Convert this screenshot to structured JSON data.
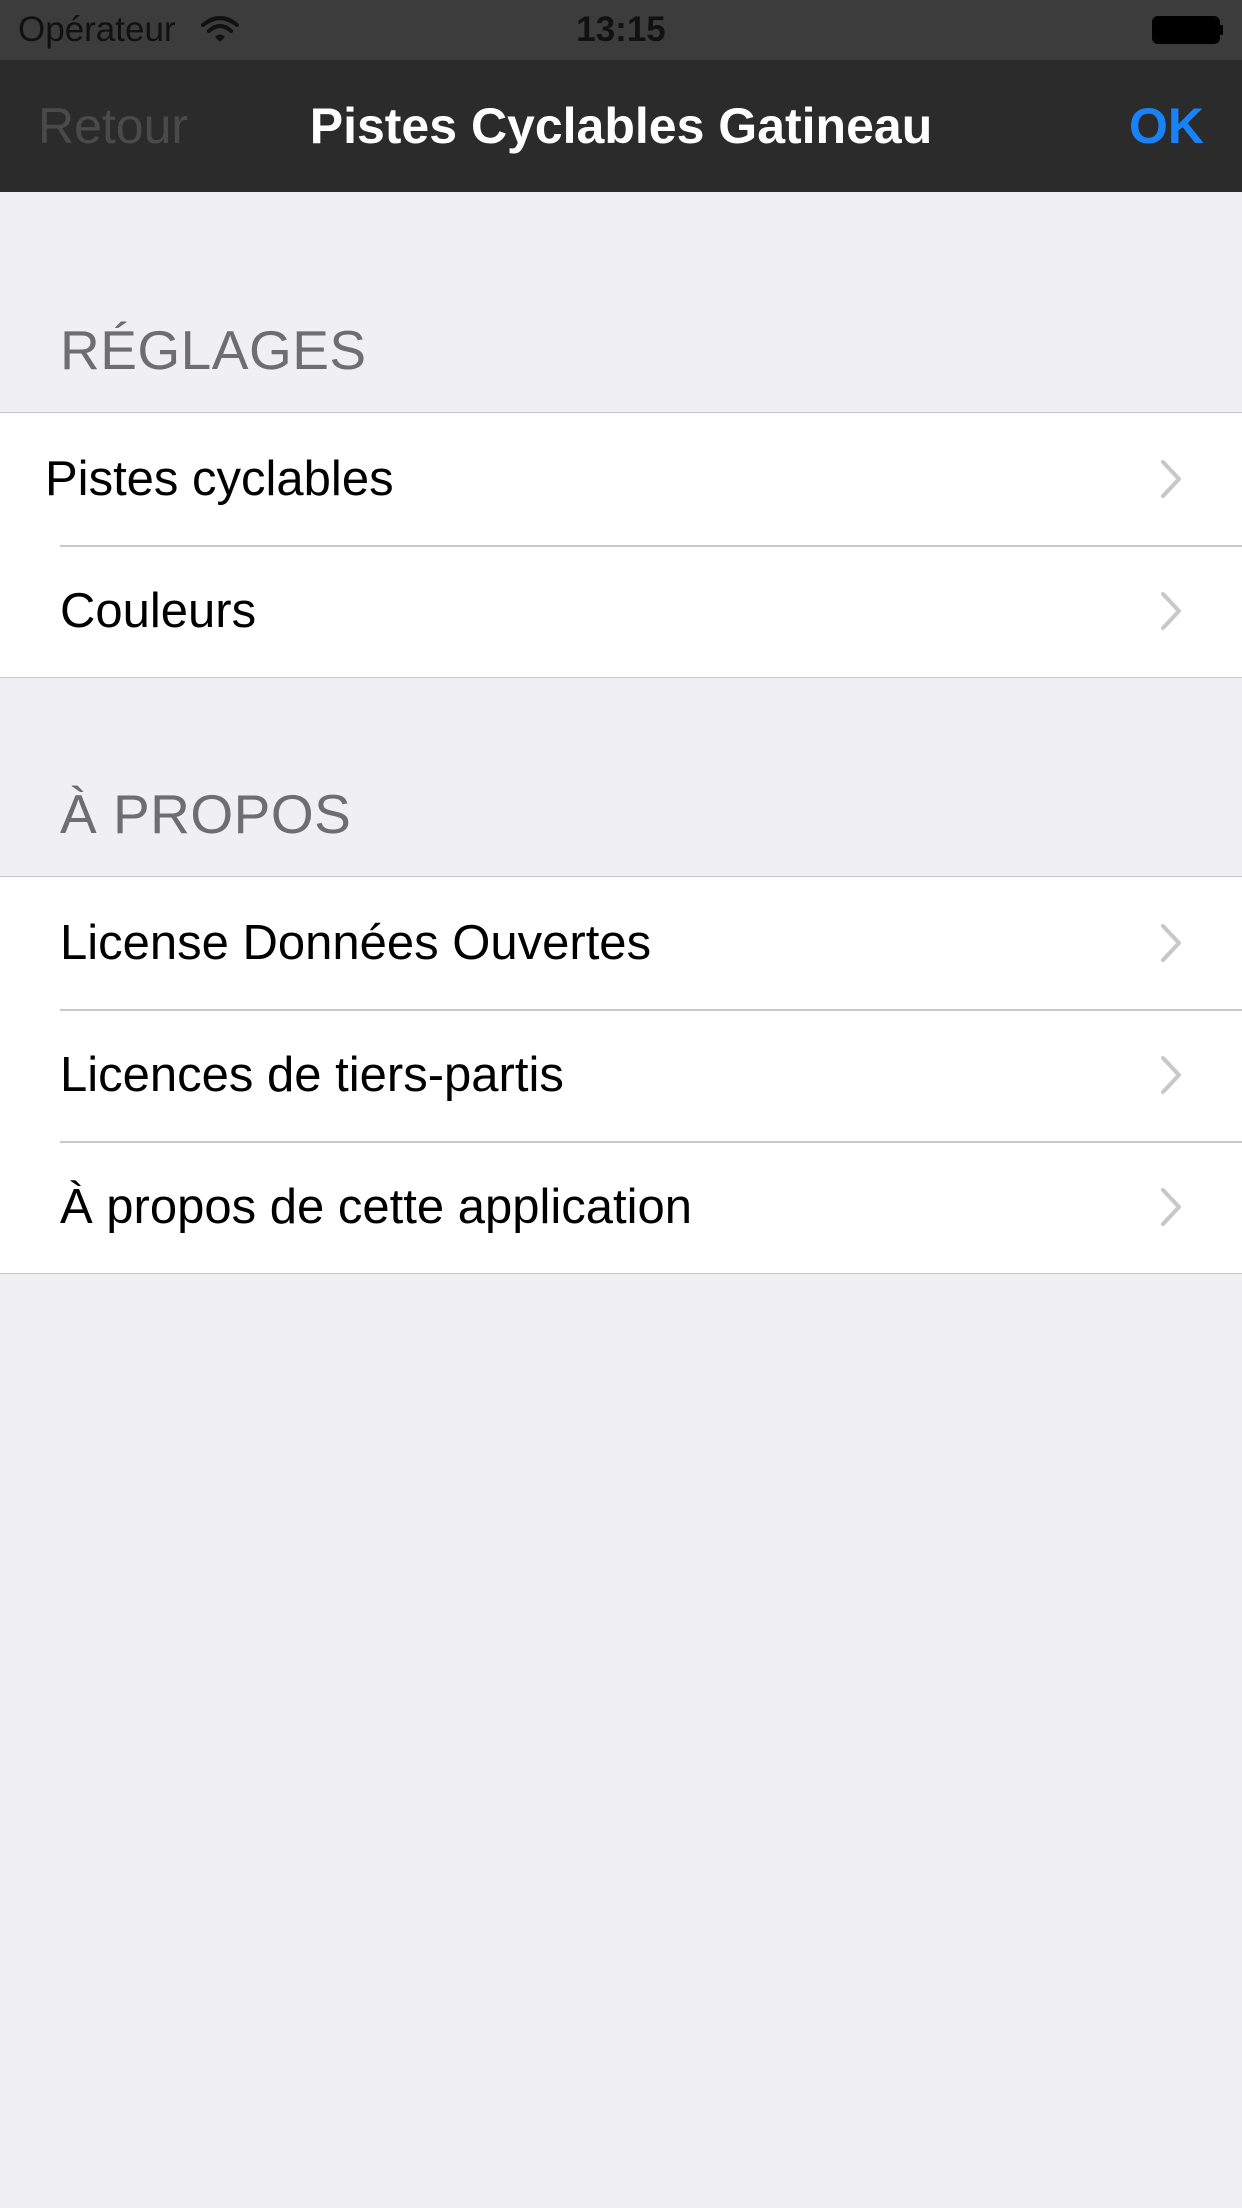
{
  "status_bar": {
    "carrier": "Opérateur",
    "time": "13:15"
  },
  "nav": {
    "back_label": "Retour",
    "title": "Pistes Cyclables Gatineau",
    "ok_label": "OK"
  },
  "sections": [
    {
      "header": "RÉGLAGES",
      "items": [
        {
          "label": "Pistes cyclables"
        },
        {
          "label": "Couleurs"
        }
      ]
    },
    {
      "header": "À PROPOS",
      "items": [
        {
          "label": "License Données Ouvertes"
        },
        {
          "label": "Licences de tiers-partis"
        },
        {
          "label": "À propos de cette application"
        }
      ]
    }
  ],
  "icons": {
    "wifi": "wifi-icon",
    "battery": "battery-icon",
    "chevron": "chevron-right-icon"
  },
  "colors": {
    "accent": "#1a82f7",
    "nav_background": "#2b2b2b",
    "page_background": "#efeff4"
  }
}
